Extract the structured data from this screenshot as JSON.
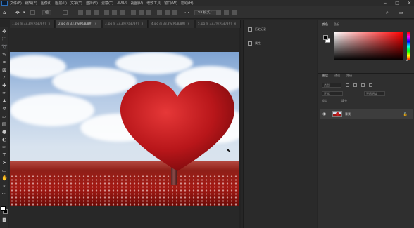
{
  "app": {
    "name": "Adobe Photoshop"
  },
  "menubar": {
    "items": [
      "文件(F)",
      "编辑(E)",
      "图像(I)",
      "图层(L)",
      "文字(Y)",
      "选择(S)",
      "滤镜(T)",
      "3D(D)",
      "视图(V)",
      "增效工具",
      "窗口(W)",
      "帮助(H)"
    ],
    "window_controls": [
      "−",
      "□",
      "✕"
    ]
  },
  "options_bar": {
    "move_tool_icon": "move-icon",
    "auto_select_label": "组",
    "mode_label": "3D 模式："
  },
  "document_tabs": [
    {
      "label": "1.jpg @ 33.3%(RGB/8#)",
      "active": false
    },
    {
      "label": "2.jpg @ 33.3%(RGB/8#)",
      "active": true
    },
    {
      "label": "3.jpg @ 33.3%(RGB/8#)",
      "active": false
    },
    {
      "label": "4.jpg @ 33.3%(RGB/8#)",
      "active": false
    },
    {
      "label": "5.jpg @ 33.3%(RGB/8#)",
      "active": false
    }
  ],
  "tools": [
    "move-icon",
    "marquee-icon",
    "lasso-icon",
    "quick-select-icon",
    "crop-icon",
    "frame-icon",
    "eyedropper-icon",
    "healing-icon",
    "brush-icon",
    "stamp-icon",
    "history-brush-icon",
    "eraser-icon",
    "gradient-icon",
    "blur-icon",
    "dodge-icon",
    "pen-icon",
    "type-icon",
    "path-select-icon",
    "shape-icon",
    "hand-icon",
    "zoom-icon",
    "more-icon"
  ],
  "collapsed_panels": [
    {
      "label": "历史记录",
      "icon": "history-icon"
    },
    {
      "label": "属性",
      "icon": "properties-icon"
    }
  ],
  "color_panel": {
    "tabs": [
      "颜色",
      "色板"
    ],
    "foreground": "#000000",
    "background": "#ffffff",
    "hue": "#ff0000"
  },
  "layers_panel": {
    "tabs": [
      "图层",
      "通道",
      "路径"
    ],
    "filter_placeholder": "类型",
    "blend_mode": "正常",
    "opacity_label": "不透明度",
    "lock_label": "锁定",
    "fill_label": "填充",
    "layers": [
      {
        "name": "背景",
        "visible": true,
        "locked": true
      }
    ]
  },
  "colors": {
    "ui_dark": "#262626",
    "panel": "#2f2f2f",
    "accent_red": "#b81c1c"
  }
}
